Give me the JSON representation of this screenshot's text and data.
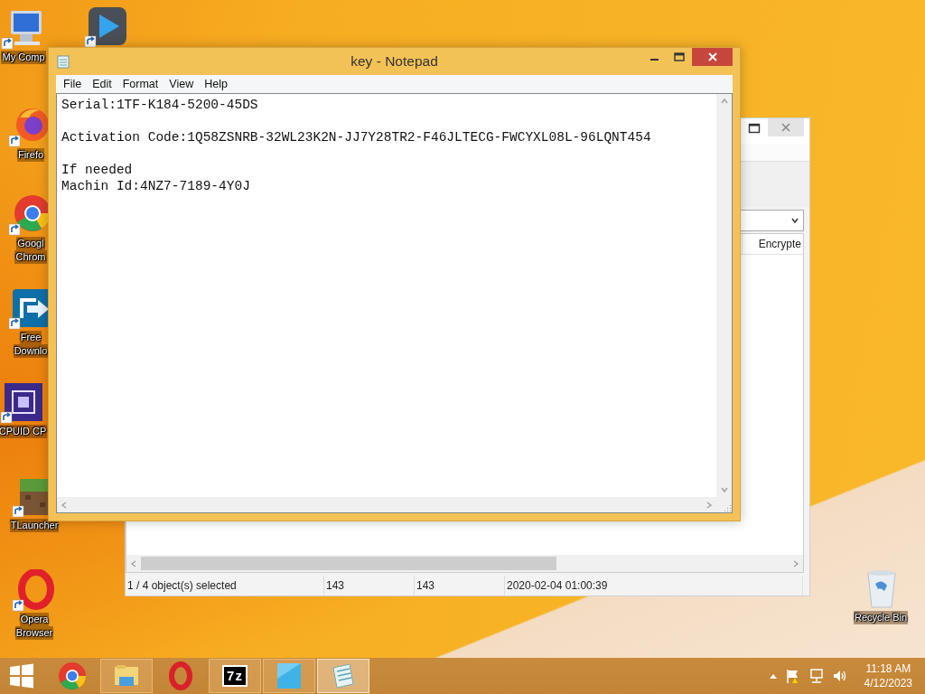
{
  "desktop": {
    "icons": [
      {
        "kind": "computer",
        "label": [
          "My Comp"
        ]
      },
      {
        "kind": "player"
      },
      {
        "kind": "firefox",
        "label": [
          "Firefo"
        ]
      },
      {
        "kind": "chrome",
        "label": [
          "Googl",
          "Chrom"
        ]
      },
      {
        "kind": "download",
        "label": [
          "Free",
          "Downlo"
        ]
      },
      {
        "kind": "cpuid",
        "label": [
          "CPUID CP"
        ]
      },
      {
        "kind": "grass",
        "label": [
          "TLauncher"
        ]
      },
      {
        "kind": "opera",
        "label": [
          "Opera",
          "Browser"
        ]
      },
      {
        "kind": "recycle",
        "label": [
          "Recycle Bin"
        ]
      }
    ]
  },
  "background_window": {
    "column_header": "Encrypte",
    "status_bar": [
      "1 / 4 object(s) selected",
      "143",
      "143",
      "2020-02-04 01:00:39"
    ]
  },
  "notepad": {
    "title": "key - Notepad",
    "menu": [
      "File",
      "Edit",
      "Format",
      "View",
      "Help"
    ],
    "paragraphs": [
      [
        "Serial:1TF-K184-5200-45DS"
      ],
      [
        "Activation Code:1Q58ZSNRB-32WL23K2N-JJ7Y28TR2-F46JLTECG-FWCYXL08L-96LQNT454"
      ],
      [
        "If needed",
        "Machin Id:4NZ7-7189-4Y0J"
      ]
    ]
  },
  "taskbar": {
    "apps": [
      {
        "kind": "chrome",
        "running": false,
        "selected": false
      },
      {
        "kind": "explorer",
        "running": true,
        "selected": false
      },
      {
        "kind": "opera",
        "running": false,
        "selected": false
      },
      {
        "kind": "sevenzip",
        "logo_text": "7z",
        "running": true,
        "selected": false
      },
      {
        "kind": "blue",
        "running": true,
        "selected": false
      },
      {
        "kind": "notepad",
        "running": true,
        "selected": true
      }
    ],
    "tray": {
      "time": "11:18 AM",
      "date": "4/12/2023"
    }
  }
}
